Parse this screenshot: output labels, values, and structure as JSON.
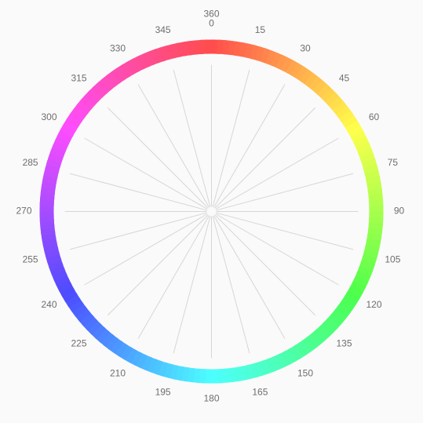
{
  "wheel": {
    "labels": [
      "0",
      "15",
      "30",
      "45",
      "60",
      "75",
      "90",
      "105",
      "120",
      "135",
      "150",
      "165",
      "180",
      "195",
      "210",
      "225",
      "240",
      "255",
      "270",
      "285",
      "300",
      "315",
      "330",
      "345"
    ],
    "top_label": "360",
    "ring_hue_start": 0,
    "ring_hue_end": 360,
    "ring_saturation": "100%",
    "ring_lightness": "65%",
    "spoke_color": "#d6d6d6",
    "label_color": "#6e6e6e",
    "background_color": "#fafafa"
  }
}
